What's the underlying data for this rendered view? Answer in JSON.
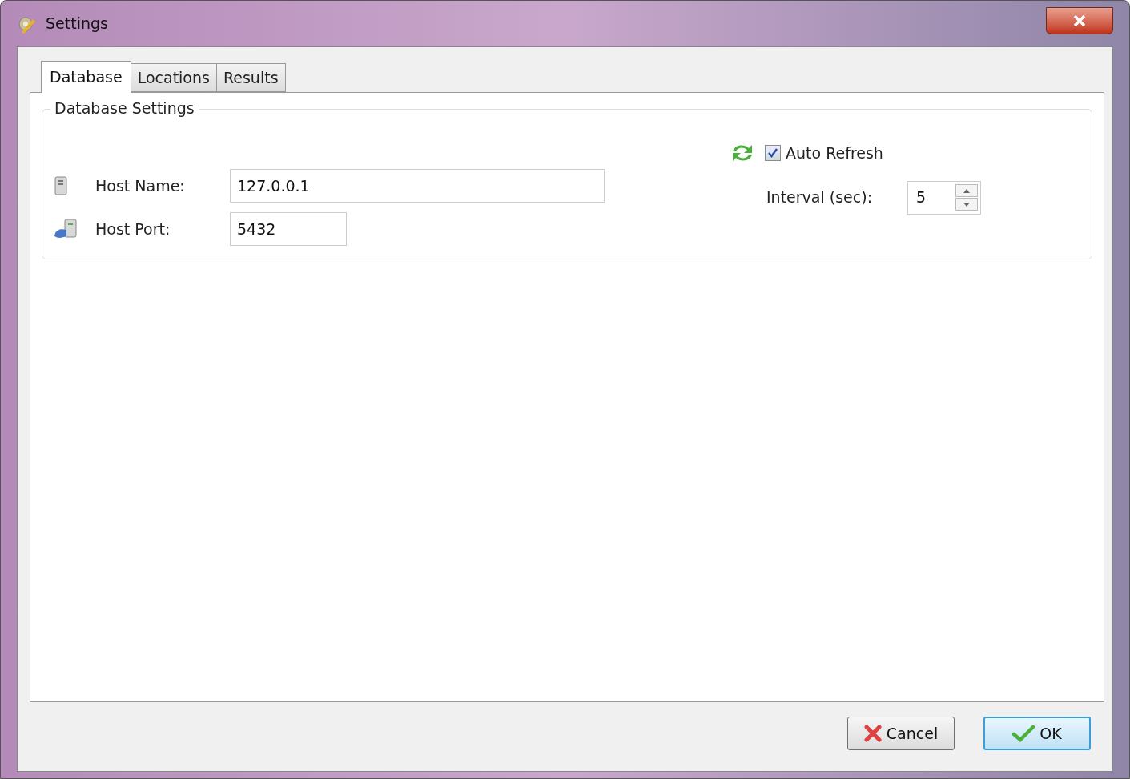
{
  "window": {
    "title": "Settings"
  },
  "tabs": [
    {
      "label": "Database",
      "selected": true
    },
    {
      "label": "Locations",
      "selected": false
    },
    {
      "label": "Results",
      "selected": false
    }
  ],
  "group": {
    "title": "Database Settings"
  },
  "fields": [
    {
      "kind": "host",
      "label": "Host Name:",
      "value": "127.0.0.1"
    },
    {
      "kind": "port",
      "label": "Host Port:",
      "value": "5432"
    }
  ],
  "auto_refresh": {
    "label": "Auto Refresh",
    "checked": true
  },
  "interval": {
    "label": "Interval (sec):",
    "value": "5"
  },
  "buttons": [
    {
      "kind": "cancel",
      "label": "Cancel"
    },
    {
      "kind": "ok",
      "label": "OK"
    }
  ]
}
